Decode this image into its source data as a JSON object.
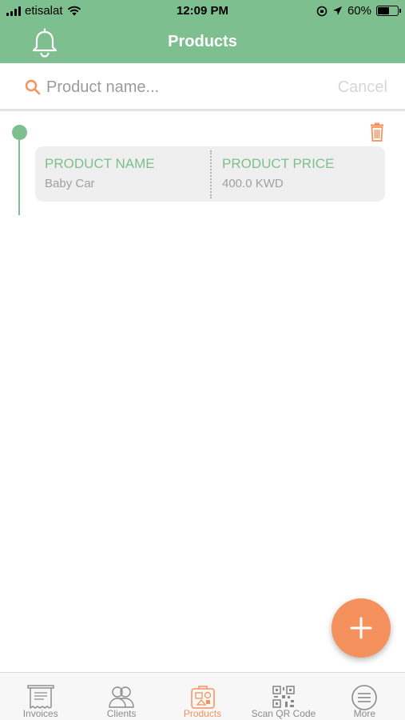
{
  "status_bar": {
    "carrier": "etisalat",
    "time": "12:09 PM",
    "battery": "60%",
    "battery_level": 0.6
  },
  "header": {
    "title": "Products"
  },
  "search": {
    "placeholder": "Product name...",
    "value": "",
    "cancel_label": "Cancel"
  },
  "products": [
    {
      "name_header": "PRODUCT NAME",
      "name": "Baby Car",
      "price_header": "PRODUCT PRICE",
      "price": "400.0 KWD"
    }
  ],
  "tabs": [
    {
      "label": "Invoices",
      "icon": "receipt-icon",
      "active": false
    },
    {
      "label": "Clients",
      "icon": "people-icon",
      "active": false
    },
    {
      "label": "Products",
      "icon": "products-bag-icon",
      "active": true
    },
    {
      "label": "Scan QR Code",
      "icon": "qr-code-icon",
      "active": false
    },
    {
      "label": "More",
      "icon": "menu-circle-icon",
      "active": false
    }
  ],
  "colors": {
    "primary_green": "#7dbf8e",
    "accent_orange": "#f5915d",
    "card_background": "#efefef"
  }
}
